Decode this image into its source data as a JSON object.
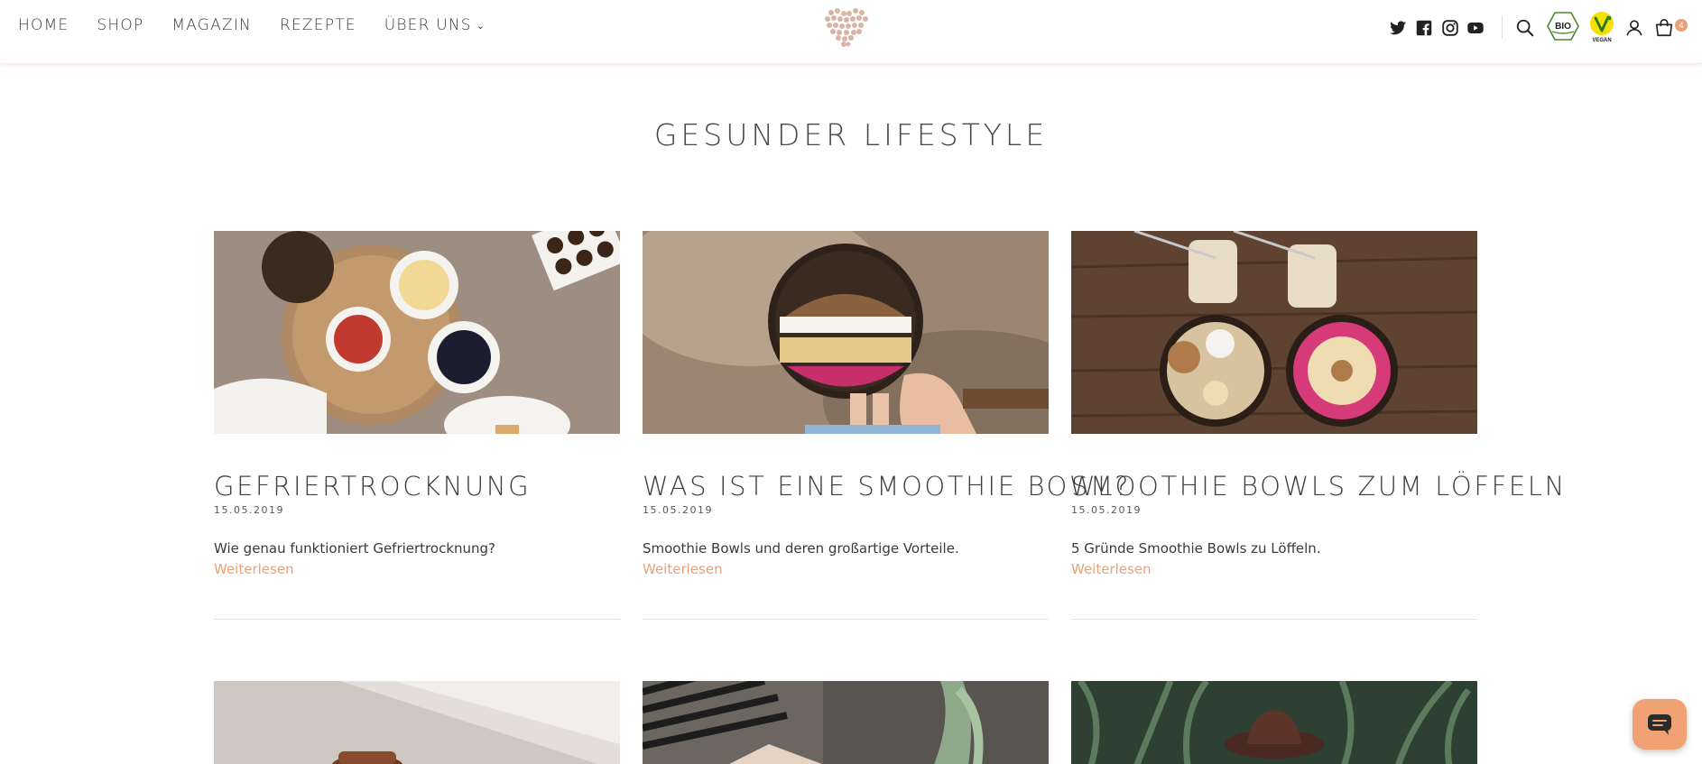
{
  "nav": {
    "items": [
      {
        "label": "HOME"
      },
      {
        "label": "SHOP"
      },
      {
        "label": "MAGAZIN"
      },
      {
        "label": "REZEPTE"
      },
      {
        "label": "ÜBER UNS"
      }
    ]
  },
  "header": {
    "cart_count": "4",
    "bio_label": "BIO",
    "vegan_label": "VEGAN"
  },
  "page": {
    "title": "GESUNDER LIFESTYLE"
  },
  "articles": [
    {
      "title": "GEFRIERTROCKNUNG",
      "date": "15.05.2019",
      "excerpt": "Wie genau funktioniert Gefriertrocknung?",
      "more": "Weiterlesen"
    },
    {
      "title": "WAS IST EINE SMOOTHIE BOWL?",
      "date": "15.05.2019",
      "excerpt": "Smoothie Bowls und deren großartige Vorteile.",
      "more": "Weiterlesen"
    },
    {
      "title": "SMOOTHIE BOWLS ZUM LÖFFELN",
      "date": "15.05.2019",
      "excerpt": "5 Gründe Smoothie Bowls zu Löffeln.",
      "more": "Weiterlesen"
    }
  ],
  "colors": {
    "accent": "#e9a17a",
    "text": "#3a3a3a",
    "chat": "#f0a274"
  }
}
